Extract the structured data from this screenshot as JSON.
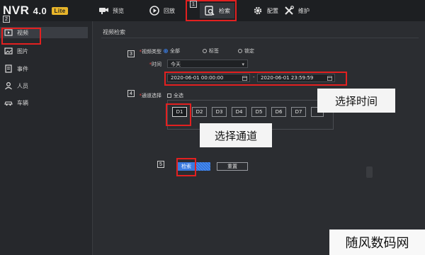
{
  "app": {
    "logo_text": "NVR",
    "version": "4.0",
    "edition_badge": "Lite"
  },
  "nav": {
    "items": [
      {
        "label": "预览",
        "icon": "camera-icon"
      },
      {
        "label": "回放",
        "icon": "playback-icon"
      },
      {
        "label": "检索",
        "icon": "search-icon",
        "active": true
      },
      {
        "label": "配置",
        "icon": "gear-icon"
      },
      {
        "label": "维护",
        "icon": "wrench-icon"
      }
    ]
  },
  "sidebar": {
    "items": [
      {
        "label": "视频",
        "icon": "video-icon",
        "selected": true
      },
      {
        "label": "图片",
        "icon": "picture-icon"
      },
      {
        "label": "事件",
        "icon": "event-icon"
      },
      {
        "label": "人员",
        "icon": "person-icon"
      },
      {
        "label": "车辆",
        "icon": "car-icon"
      }
    ]
  },
  "form": {
    "breadcrumb": "视频检索",
    "video_type_label": "视频类型",
    "video_type_options": [
      "全部",
      "标签",
      "锁定"
    ],
    "video_type_selected": "全部",
    "time_label": "时间",
    "time_select_value": "今天",
    "start_time": "2020-06-01 00:00:00",
    "end_time": "2020-06-01 23:59:59",
    "range_separator": "-",
    "channel_label": "通道选择",
    "select_all_label": "全选",
    "channels": [
      "D1",
      "D2",
      "D3",
      "D4",
      "D5",
      "D6",
      "D7"
    ],
    "search_button": "检索",
    "reset_button": "重置"
  },
  "annotations": {
    "steps": [
      "1",
      "2",
      "3",
      "4",
      "5"
    ],
    "callout_time": "选择时间",
    "callout_channel": "选择通道",
    "watermark": "随风数码网",
    "highlight_color": "#e32020"
  },
  "colors": {
    "accent": "#3a7be0",
    "topbar": "#1d1f22",
    "background": "#2b2d31"
  }
}
